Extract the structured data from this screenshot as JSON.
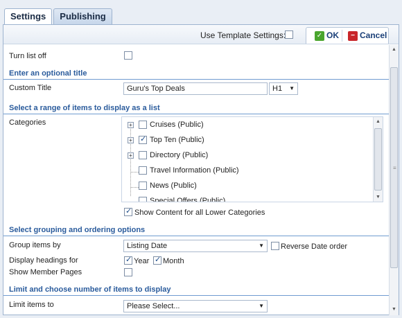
{
  "tabs": [
    {
      "label": "Settings",
      "active": true
    },
    {
      "label": "Publishing",
      "active": false
    }
  ],
  "toolbar": {
    "use_template_label": "Use Template Settings:",
    "use_template_checked": false,
    "ok_label": "OK",
    "cancel_label": "Cancel"
  },
  "turn_list_off": {
    "label": "Turn list off",
    "checked": false
  },
  "sections": {
    "title": "Enter an optional title",
    "range": "Select a range of items to display as a list",
    "grouping": "Select grouping and ordering options",
    "limit": "Limit and choose number of items to display"
  },
  "custom_title": {
    "label": "Custom Title",
    "value": "Guru's Top Deals",
    "heading_level": "H1"
  },
  "categories": {
    "label": "Categories",
    "items": [
      {
        "label": "Cruises (Public)",
        "checked": false,
        "expandable": true
      },
      {
        "label": "Top Ten (Public)",
        "checked": true,
        "expandable": true
      },
      {
        "label": "Directory (Public)",
        "checked": false,
        "expandable": true
      },
      {
        "label": "Travel Information (Public)",
        "checked": false,
        "expandable": false
      },
      {
        "label": "News (Public)",
        "checked": false,
        "expandable": false
      },
      {
        "label": "Special Offers (Public)",
        "checked": false,
        "expandable": false
      }
    ],
    "show_lower_label": "Show Content for all Lower Categories",
    "show_lower_checked": true
  },
  "group_by": {
    "label": "Group items by",
    "value": "Listing Date",
    "reverse_label": "Reverse Date order",
    "reverse_checked": false
  },
  "display_headings": {
    "label": "Display headings for",
    "year_label": "Year",
    "year_checked": true,
    "month_label": "Month",
    "month_checked": true
  },
  "show_member_pages": {
    "label": "Show Member Pages",
    "checked": false
  },
  "limit_items": {
    "label": "Limit items to",
    "value": "Please Select..."
  },
  "colors": {
    "accent": "#2a5b9c",
    "ok": "#4aa52e",
    "cancel": "#c8262a"
  }
}
